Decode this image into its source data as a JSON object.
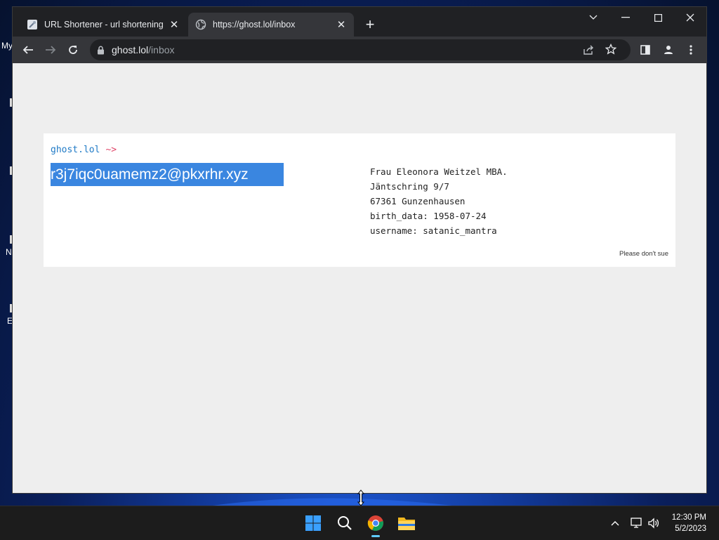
{
  "desktop": {
    "labels": [
      "My",
      "N",
      "E"
    ]
  },
  "browser": {
    "tabs": [
      {
        "title": "URL Shortener - url shortening se",
        "icon": "url-shortener-favicon",
        "active": false
      },
      {
        "title": "https://ghost.lol/inbox",
        "icon": "globe-icon",
        "active": true
      }
    ],
    "new_tab_label": "+",
    "url_host": "ghost.lol",
    "url_path": "/inbox"
  },
  "page": {
    "prompt_host": "ghost.lol",
    "prompt_arrow": "~>",
    "email": "r3j7iqc0uamemz2@pkxrhr.xyz",
    "identity": {
      "name": "Frau Eleonora Weitzel MBA.",
      "street": "Jäntschring 9/7",
      "city": "67361 Gunzenhausen",
      "birth": "birth_data: 1958-07-24",
      "username": "username: satanic_mantra"
    },
    "footer_note": "Please don't sue"
  },
  "taskbar": {
    "apps": [
      "start-button",
      "search",
      "chrome",
      "file-explorer"
    ],
    "time": "12:30 PM",
    "date": "5/2/2023"
  },
  "colors": {
    "selection": "#3a86e0",
    "prompt_host": "#1f7ac6",
    "prompt_arrow": "#e0476a",
    "page_bg": "#eeeeee"
  }
}
